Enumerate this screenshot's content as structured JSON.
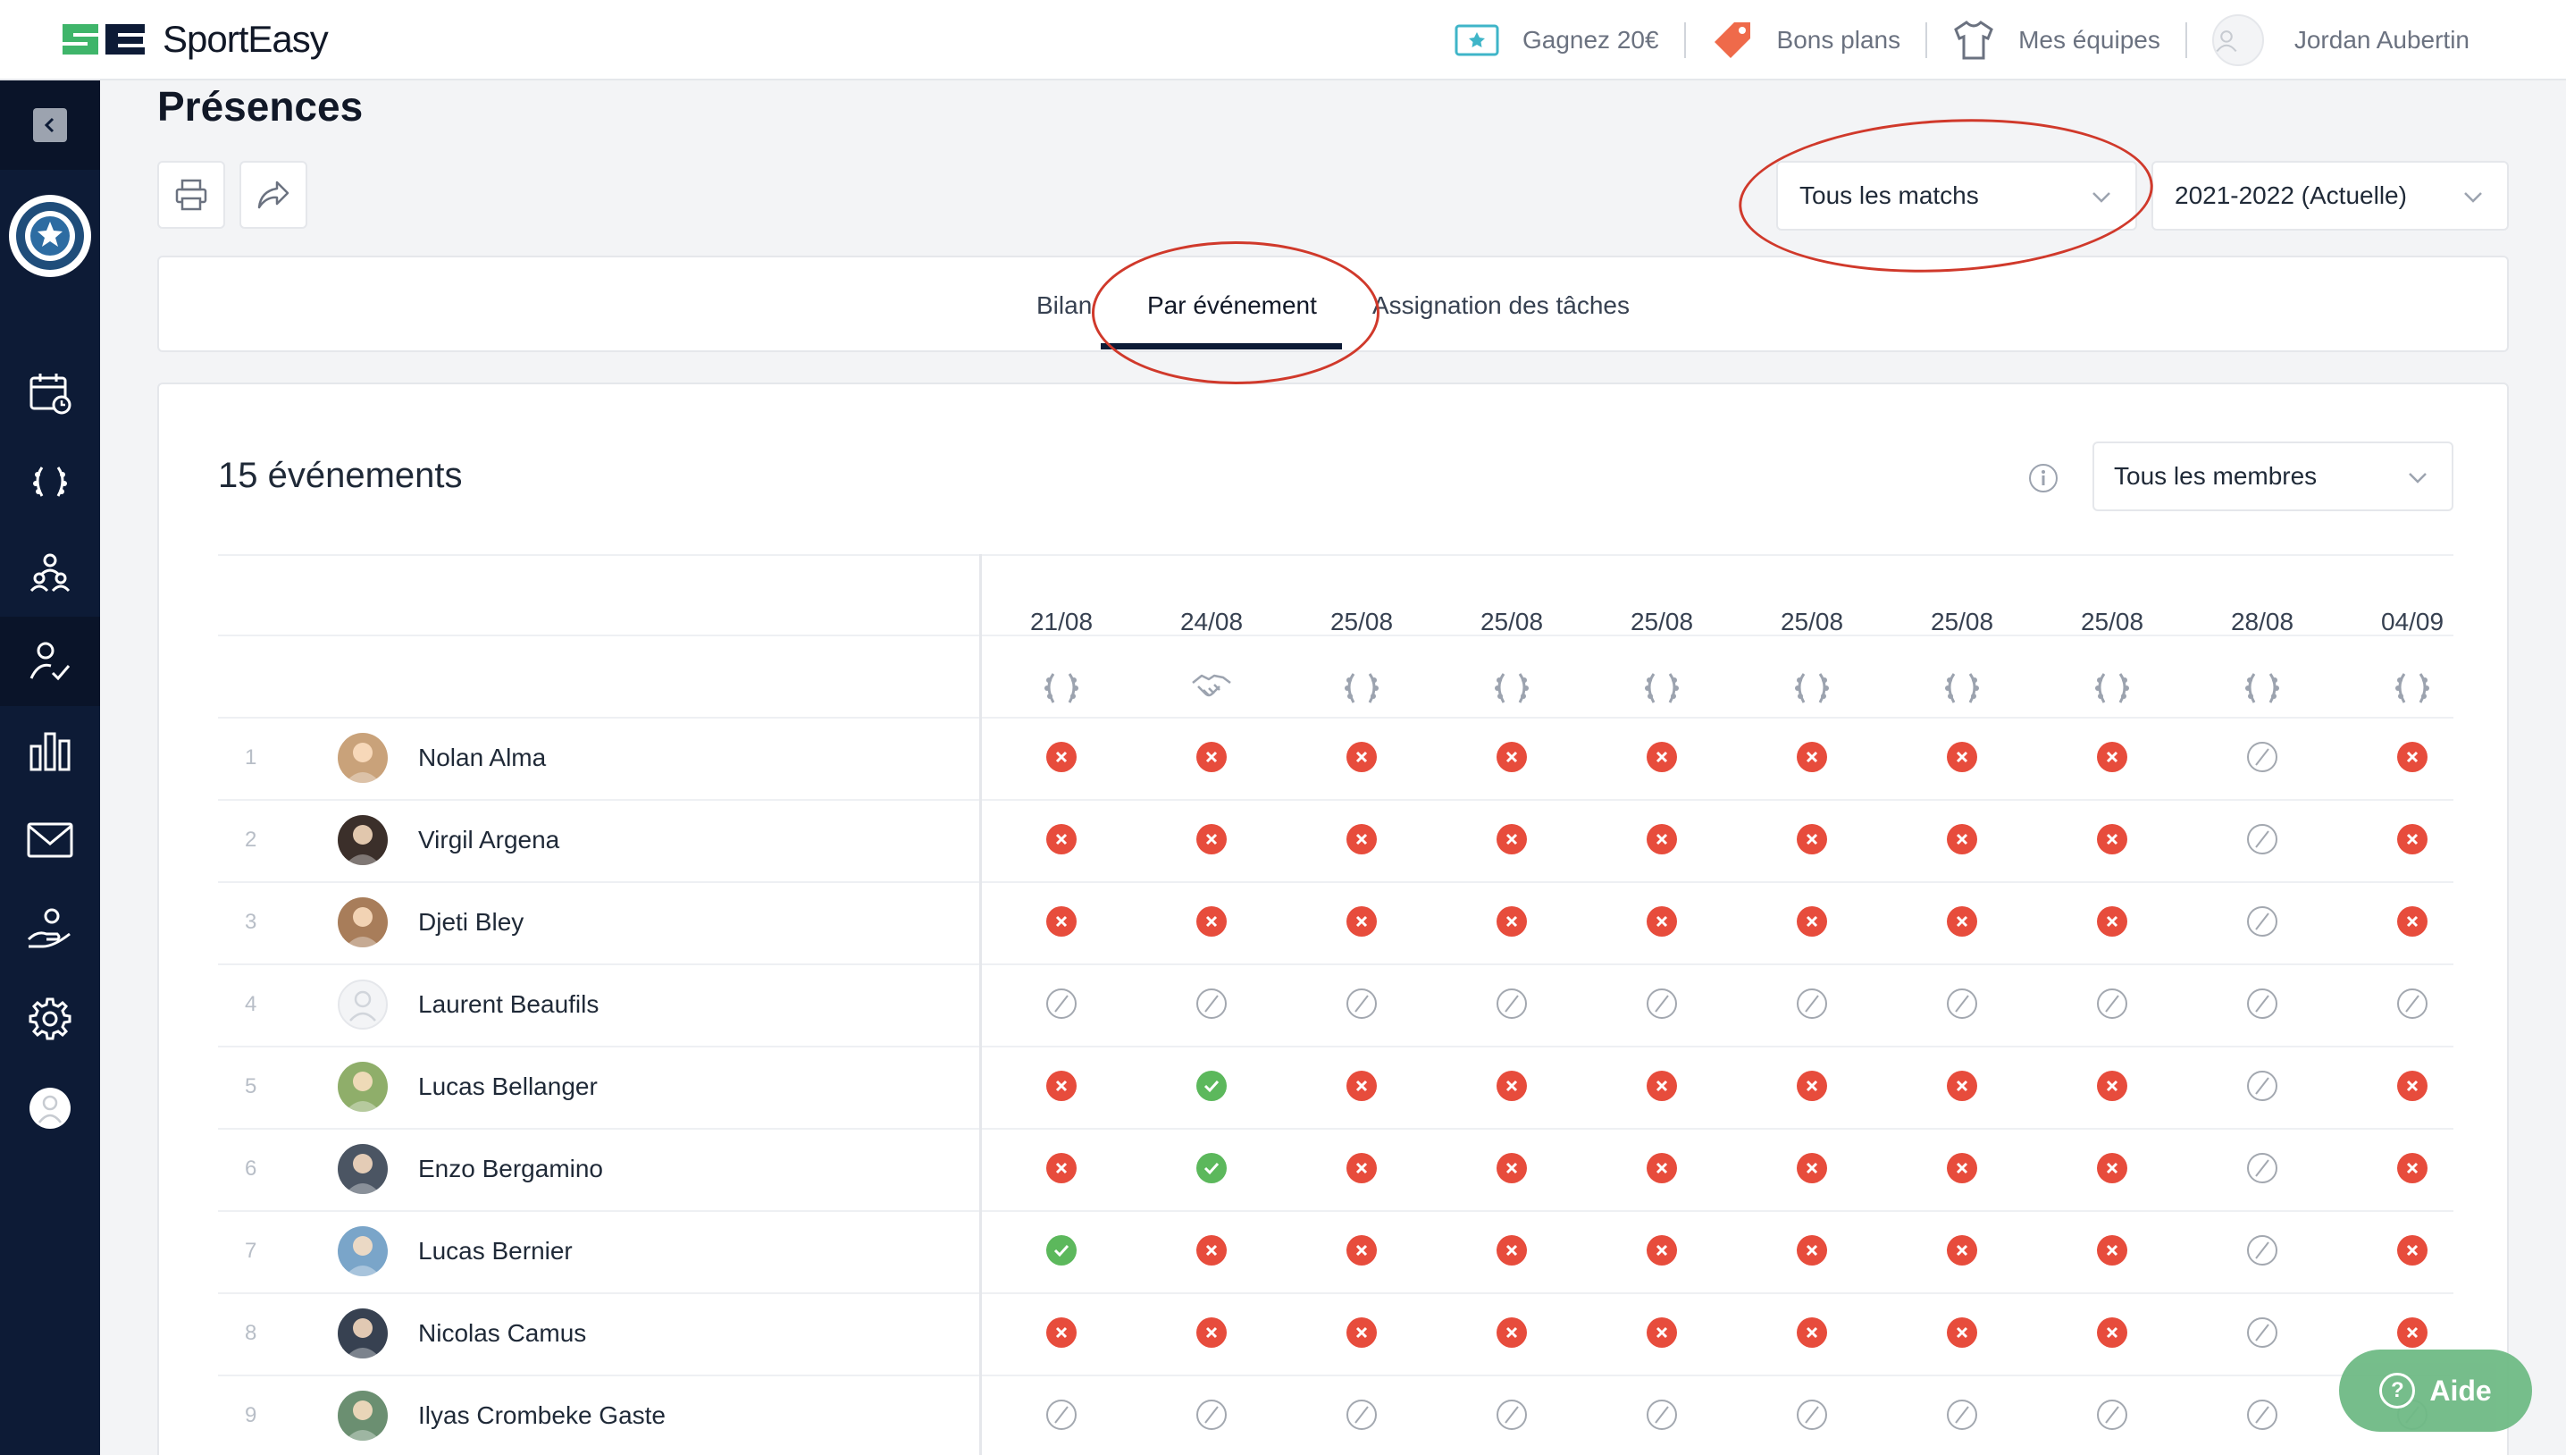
{
  "brand": {
    "name": "SportEasy",
    "accent": "#3fb56a",
    "dark": "#0d1b36"
  },
  "topnav": {
    "earn": "Gagnez 20€",
    "deals": "Bons plans",
    "teams": "Mes équipes",
    "user": "Jordan Aubertin"
  },
  "page": {
    "title": "Présences"
  },
  "filters": {
    "matches": "Tous les matchs",
    "season": "2021-2022 (Actuelle)",
    "members": "Tous les membres"
  },
  "tabs": [
    "Bilan",
    "Par événement",
    "Assignation des tâches"
  ],
  "active_tab": "Par événement",
  "events": {
    "count_label": "15 événements",
    "dates": [
      "21/08",
      "24/08",
      "25/08",
      "25/08",
      "25/08",
      "25/08",
      "25/08",
      "25/08",
      "28/08",
      "04/09"
    ],
    "types": [
      "match",
      "friendly",
      "match",
      "match",
      "match",
      "match",
      "match",
      "match",
      "match",
      "match"
    ]
  },
  "members": [
    {
      "num": "1",
      "name": "Nolan Alma",
      "statuses": [
        "absent",
        "absent",
        "absent",
        "absent",
        "absent",
        "absent",
        "absent",
        "absent",
        "unknown",
        "absent"
      ]
    },
    {
      "num": "2",
      "name": "Virgil Argena",
      "statuses": [
        "absent",
        "absent",
        "absent",
        "absent",
        "absent",
        "absent",
        "absent",
        "absent",
        "unknown",
        "absent"
      ]
    },
    {
      "num": "3",
      "name": "Djeti Bley",
      "statuses": [
        "absent",
        "absent",
        "absent",
        "absent",
        "absent",
        "absent",
        "absent",
        "absent",
        "unknown",
        "absent"
      ]
    },
    {
      "num": "4",
      "name": "Laurent Beaufils",
      "statuses": [
        "unknown",
        "unknown",
        "unknown",
        "unknown",
        "unknown",
        "unknown",
        "unknown",
        "unknown",
        "unknown",
        "unknown"
      ]
    },
    {
      "num": "5",
      "name": "Lucas Bellanger",
      "statuses": [
        "absent",
        "present",
        "absent",
        "absent",
        "absent",
        "absent",
        "absent",
        "absent",
        "unknown",
        "absent"
      ]
    },
    {
      "num": "6",
      "name": "Enzo Bergamino",
      "statuses": [
        "absent",
        "present",
        "absent",
        "absent",
        "absent",
        "absent",
        "absent",
        "absent",
        "unknown",
        "absent"
      ]
    },
    {
      "num": "7",
      "name": "Lucas Bernier",
      "statuses": [
        "present",
        "absent",
        "absent",
        "absent",
        "absent",
        "absent",
        "absent",
        "absent",
        "unknown",
        "absent"
      ]
    },
    {
      "num": "8",
      "name": "Nicolas Camus",
      "statuses": [
        "absent",
        "absent",
        "absent",
        "absent",
        "absent",
        "absent",
        "absent",
        "absent",
        "unknown",
        "absent"
      ]
    },
    {
      "num": "9",
      "name": "Ilyas Crombeke Gaste",
      "statuses": [
        "unknown",
        "unknown",
        "unknown",
        "unknown",
        "unknown",
        "unknown",
        "unknown",
        "unknown",
        "unknown",
        "unknown"
      ]
    }
  ],
  "colors": {
    "absent": "#e74c3c",
    "present": "#5cb85c",
    "unknown": "#a3a8b0",
    "annotation": "#d0392b"
  },
  "help": {
    "label": "Aide"
  }
}
